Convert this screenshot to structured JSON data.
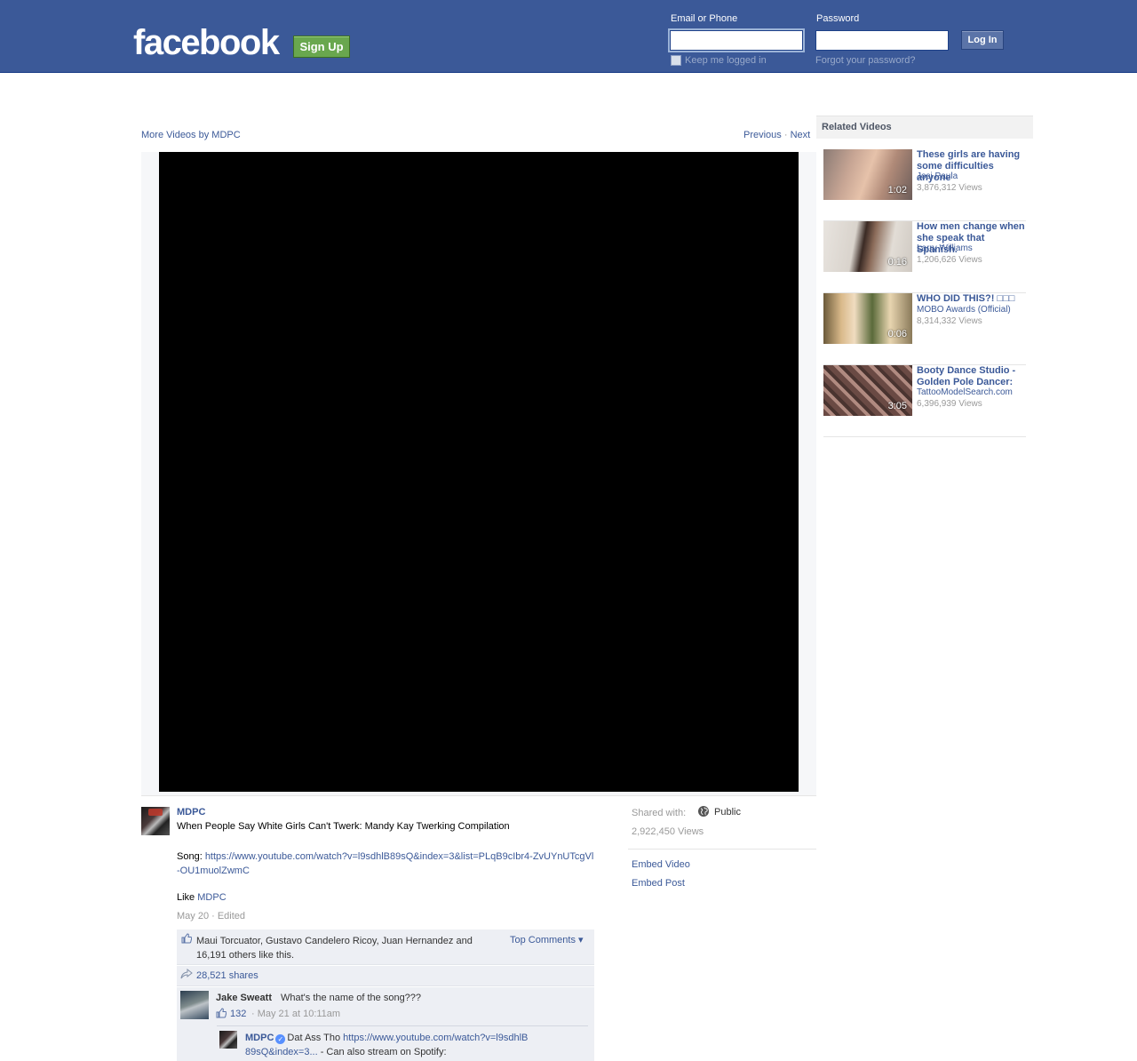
{
  "header": {
    "logo": "facebook",
    "signup_label": "Sign Up",
    "email_label": "Email or Phone",
    "password_label": "Password",
    "email_value": "",
    "password_value": "",
    "login_label": "Log In",
    "keep_logged_in": "Keep me logged in",
    "forgot_password": "Forgot your password?",
    "brand_color": "#3b5998"
  },
  "video": {
    "more_videos": "More Videos by MDPC",
    "previous": "Previous",
    "separator": "·",
    "next": "Next"
  },
  "post": {
    "author": "MDPC",
    "title": "When People Say White Girls Can't Twerk: Mandy Kay Twerking Compilation",
    "song_label": "Song: ",
    "song_url": "https://www.youtube.com/watch?v=l9sdhlB89sQ&index=3&list=PLqB9cIbr4-ZvUYnUTcgVl-OU1muolZwmC",
    "like_label": "Like ",
    "like_page": "MDPC",
    "meta": "May 20 · Edited",
    "likes_text": "Maui Torcuator, Gustavo Candelero Ricoy, Juan Hernandez and 16,191 others like this.",
    "top_comments": "Top Comments ▾",
    "shares": "28,521 shares"
  },
  "comments": [
    {
      "name": "Jake Sweatt",
      "text": "What's the name of the song???",
      "likes": "132",
      "date": "· May 21 at 10:11am",
      "reply": {
        "name": "MDPC",
        "text_before": "Dat Ass Tho ",
        "link": "https://www.youtube.com/watch?v=l9sdhlB89sQ&index=3...",
        "text_after": " - Can also stream on Spotify:"
      }
    }
  ],
  "sidebar_info": {
    "shared_label": "Shared with:",
    "shared_value": "Public",
    "views": "2,922,450 Views",
    "embed_video": "Embed Video",
    "embed_post": "Embed Post"
  },
  "related": {
    "title": "Related Videos",
    "items": [
      {
        "title": "These girls are having some difficulties anyone",
        "author": "Josi Paula",
        "views": "3,876,312 Views",
        "duration": "1:02"
      },
      {
        "title": "How men change when she speak that Spanish.",
        "author": "Larry Williams",
        "views": "1,206,626 Views",
        "duration": "0:16"
      },
      {
        "title": "WHO DID THIS?! □□□",
        "author": "MOBO Awards (Official)",
        "views": "8,314,332 Views",
        "duration": "0:06"
      },
      {
        "title": "Booty Dance Studio - Golden Pole Dancer:",
        "author": "TattooModelSearch.com",
        "views": "6,396,939 Views",
        "duration": "3:05"
      }
    ]
  },
  "icons": {
    "like": "thumbs-up-icon",
    "share": "share-arrow-icon",
    "globe": "globe-icon",
    "verified": "verified-badge-icon"
  }
}
